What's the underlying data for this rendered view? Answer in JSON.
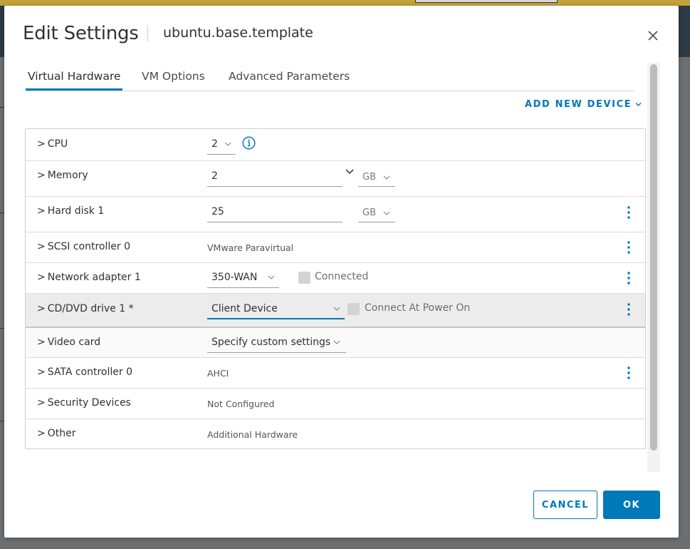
{
  "dialog": {
    "title": "Edit Settings",
    "subtitle": "ubuntu.base.template",
    "close_icon": "close-icon"
  },
  "tabs": [
    {
      "label": "Virtual Hardware",
      "active": true
    },
    {
      "label": "VM Options",
      "active": false
    },
    {
      "label": "Advanced Parameters",
      "active": false
    }
  ],
  "add_device": {
    "label": "ADD NEW DEVICE"
  },
  "hardware": {
    "cpu": {
      "label": "CPU",
      "value": "2"
    },
    "memory": {
      "label": "Memory",
      "value": "2",
      "unit": "GB"
    },
    "hard_disk": {
      "label": "Hard disk 1",
      "value": "25",
      "unit": "GB"
    },
    "scsi": {
      "label": "SCSI controller 0",
      "value": "VMware Paravirtual"
    },
    "network": {
      "label": "Network adapter 1",
      "value": "350-WAN",
      "checkbox_label": "Connected"
    },
    "cdrom": {
      "label": "CD/DVD drive 1 *",
      "value": "Client Device",
      "checkbox_label": "Connect At Power On"
    },
    "video": {
      "label": "Video card",
      "value": "Specify custom settings"
    },
    "sata": {
      "label": "SATA controller 0",
      "value": "AHCI"
    },
    "security": {
      "label": "Security Devices",
      "value": "Not Configured"
    },
    "other": {
      "label": "Other",
      "value": "Additional Hardware"
    }
  },
  "footer": {
    "cancel_label": "CANCEL",
    "ok_label": "OK"
  },
  "colors": {
    "accent": "#0079b8",
    "row_highlight": "#ececec",
    "checkbox": "#cfd4d7"
  }
}
